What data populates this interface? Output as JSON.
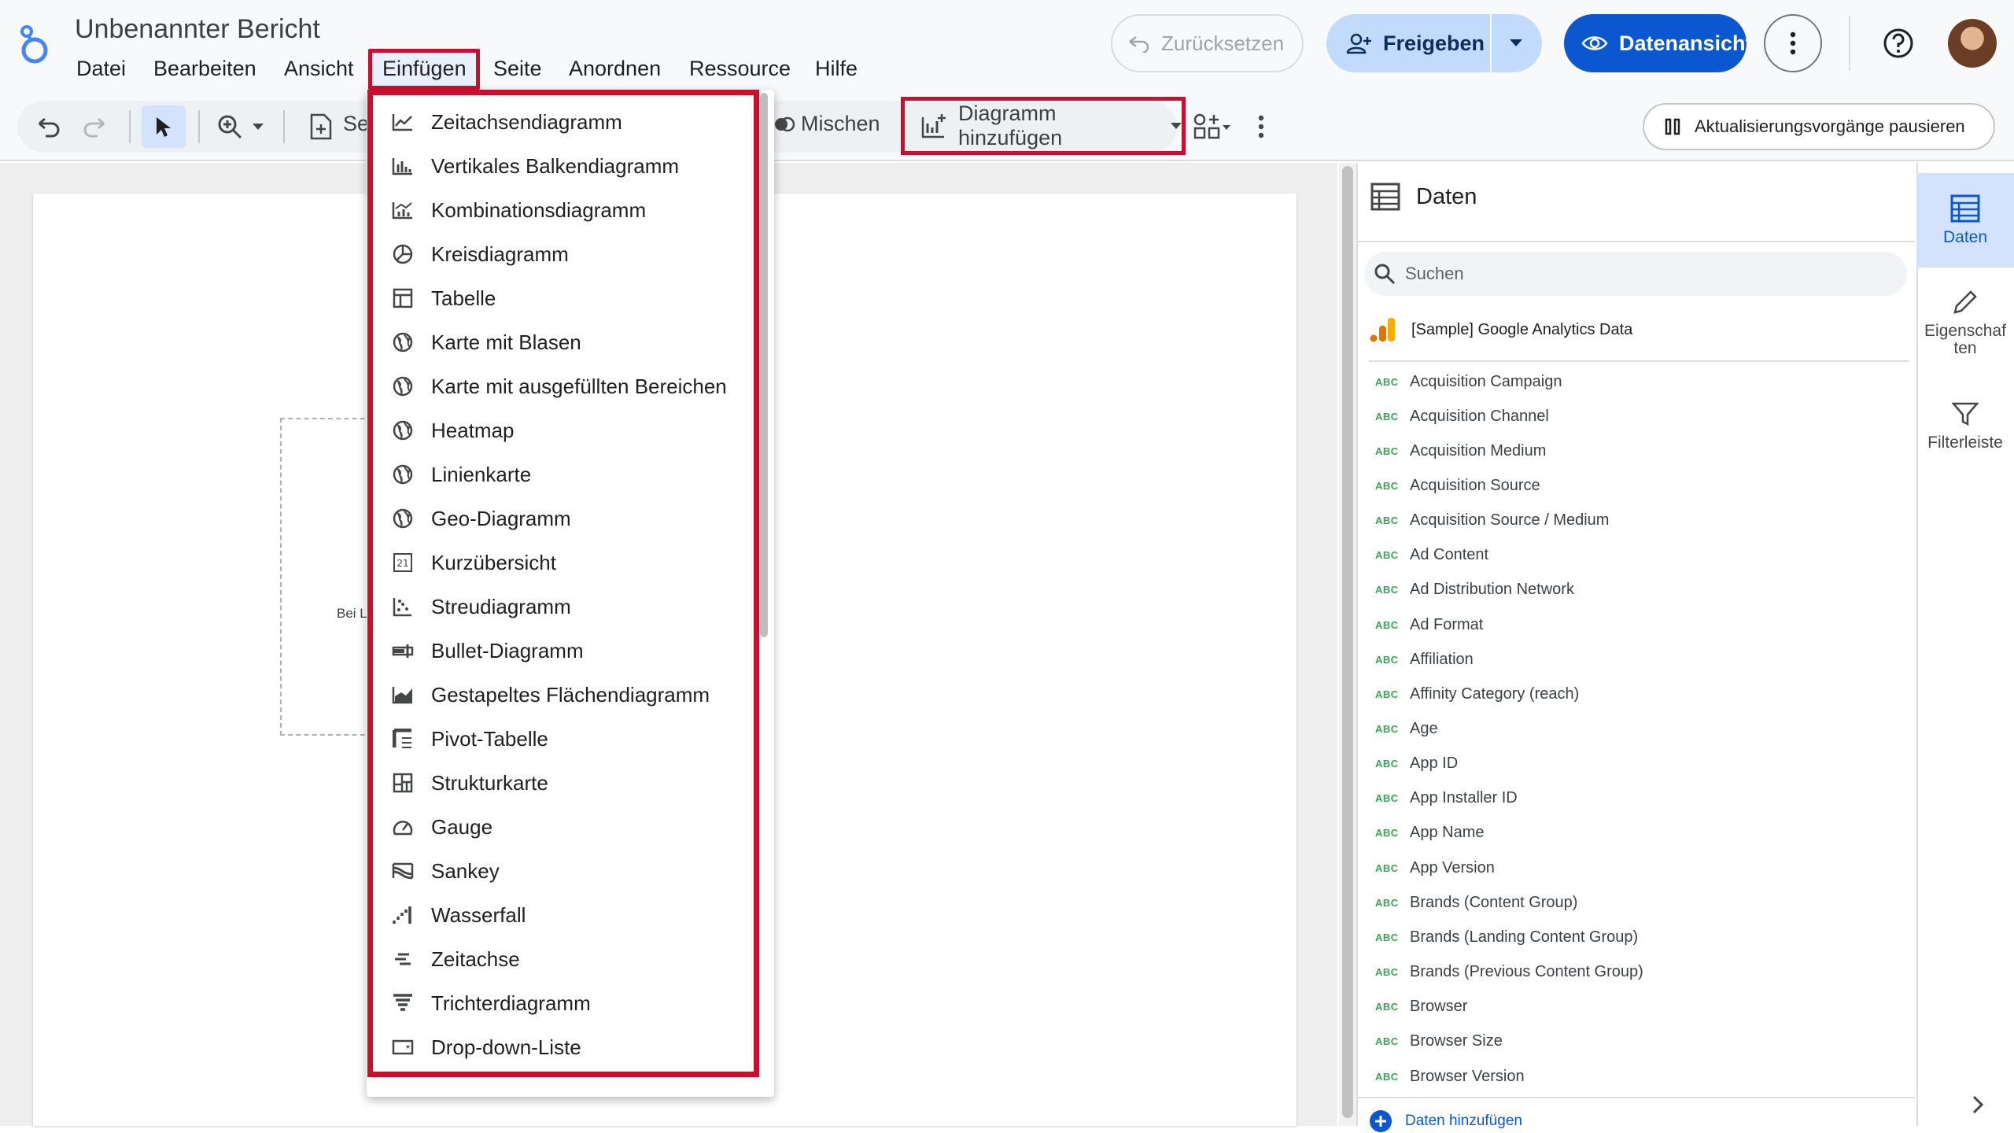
{
  "header": {
    "title": "Unbenannter Bericht",
    "menus": [
      "Datei",
      "Bearbeiten",
      "Ansicht",
      "Einfügen",
      "Seite",
      "Anordnen",
      "Ressource",
      "Hilfe"
    ],
    "reset_label": "Zurücksetzen",
    "share_label": "Freigeben",
    "view_label": "Datenansicht"
  },
  "toolbar": {
    "page_label_partial": "Se",
    "blend_label": "Mischen",
    "add_chart_label": "Diagramm hinzufügen",
    "pause_label": "Aktualisierungsvorgänge pausieren"
  },
  "canvas": {
    "placeholder_text": "Bei L"
  },
  "insert_menu": {
    "items": [
      {
        "label": "Zeitachsendiagramm",
        "icon": "timeseries-icon"
      },
      {
        "label": "Vertikales Balkendiagramm",
        "icon": "bar-chart-icon"
      },
      {
        "label": "Kombinationsdiagramm",
        "icon": "combo-chart-icon"
      },
      {
        "label": "Kreisdiagramm",
        "icon": "pie-chart-icon"
      },
      {
        "label": "Tabelle",
        "icon": "table-icon"
      },
      {
        "label": "Karte mit Blasen",
        "icon": "globe-icon"
      },
      {
        "label": "Karte mit ausgefüllten Bereichen",
        "icon": "globe-icon"
      },
      {
        "label": "Heatmap",
        "icon": "globe-icon"
      },
      {
        "label": "Linienkarte",
        "icon": "globe-icon"
      },
      {
        "label": "Geo-Diagramm",
        "icon": "globe-icon"
      },
      {
        "label": "Kurzübersicht",
        "icon": "scorecard-icon"
      },
      {
        "label": "Streudiagramm",
        "icon": "scatter-icon"
      },
      {
        "label": "Bullet-Diagramm",
        "icon": "bullet-icon"
      },
      {
        "label": "Gestapeltes Flächendiagramm",
        "icon": "area-chart-icon"
      },
      {
        "label": "Pivot-Tabelle",
        "icon": "pivot-icon"
      },
      {
        "label": "Strukturkarte",
        "icon": "treemap-icon"
      },
      {
        "label": "Gauge",
        "icon": "gauge-icon"
      },
      {
        "label": "Sankey",
        "icon": "sankey-icon"
      },
      {
        "label": "Wasserfall",
        "icon": "waterfall-icon"
      },
      {
        "label": "Zeitachse",
        "icon": "timeline-icon"
      },
      {
        "label": "Trichterdiagramm",
        "icon": "funnel-icon"
      },
      {
        "label": "Drop-down-Liste",
        "icon": "dropdown-list-icon"
      }
    ]
  },
  "data_panel": {
    "title": "Daten",
    "search_placeholder": "Suchen",
    "source_name": "[Sample] Google Analytics Data",
    "field_type": "ABC",
    "fields": [
      "Acquisition Campaign",
      "Acquisition Channel",
      "Acquisition Medium",
      "Acquisition Source",
      "Acquisition Source / Medium",
      "Ad Content",
      "Ad Distribution Network",
      "Ad Format",
      "Affiliation",
      "Affinity Category (reach)",
      "Age",
      "App ID",
      "App Installer ID",
      "App Name",
      "App Version",
      "Brands (Content Group)",
      "Brands (Landing Content Group)",
      "Brands (Previous Content Group)",
      "Browser",
      "Browser Size",
      "Browser Version"
    ],
    "add_data_label": "Daten hinzufügen"
  },
  "rail": {
    "daten": "Daten",
    "eigenschaften": "Eigenschaf ten",
    "filterleiste": "Filterleiste"
  },
  "colors": {
    "highlight": "#c8102e",
    "primary": "#0b57d0",
    "share_bg": "#c2dafc",
    "abc": "#34a853"
  }
}
